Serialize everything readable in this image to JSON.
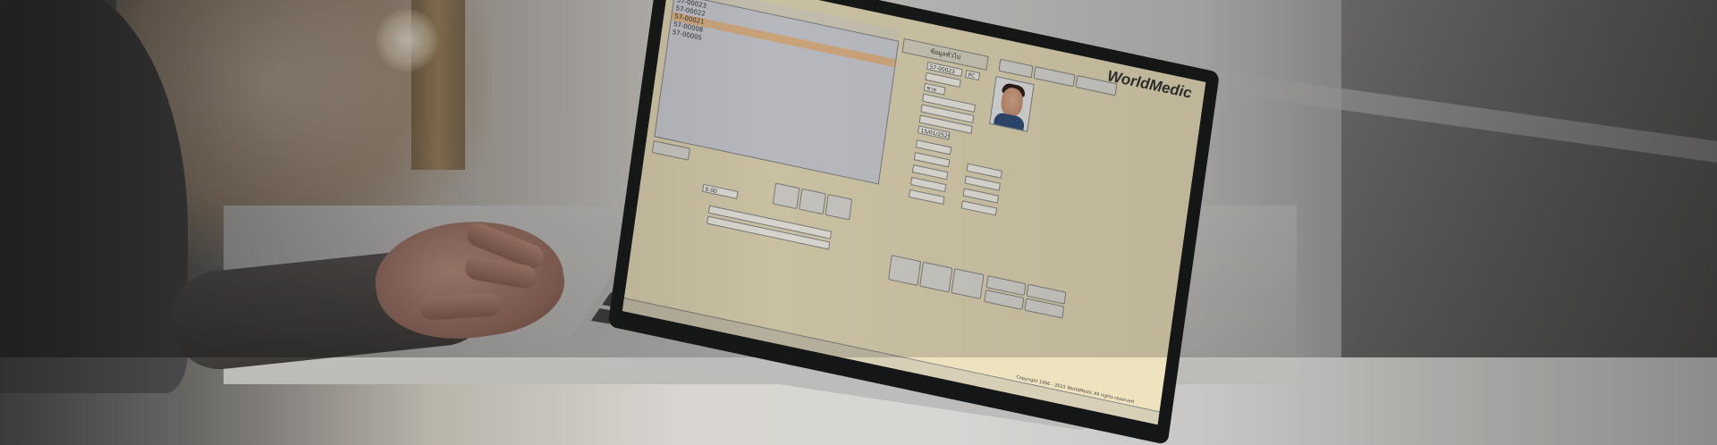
{
  "app": {
    "brand": "WorldMedic",
    "copyright": "Copyright 1996 - 2015 WorldMedic All rights reserved"
  },
  "patient_list": {
    "rows": [
      {
        "id": "57-00023",
        "selected": false
      },
      {
        "id": "57-00022",
        "selected": false
      },
      {
        "id": "57-00021",
        "selected": true
      },
      {
        "id": "57-00008",
        "selected": false
      },
      {
        "id": "57-00005",
        "selected": false
      }
    ]
  },
  "form": {
    "hn_value": "57-00023",
    "type_value": "PC",
    "sex_value": "ชาย",
    "birth_value": "15/01/2529",
    "price_value": "0.00",
    "tag_header": "ข้อมูลทั่วไป"
  },
  "colors": {
    "screen_bg": "#efe3bf",
    "selected_row": "#f0c08e",
    "list_bg": "#d9dbe2"
  }
}
